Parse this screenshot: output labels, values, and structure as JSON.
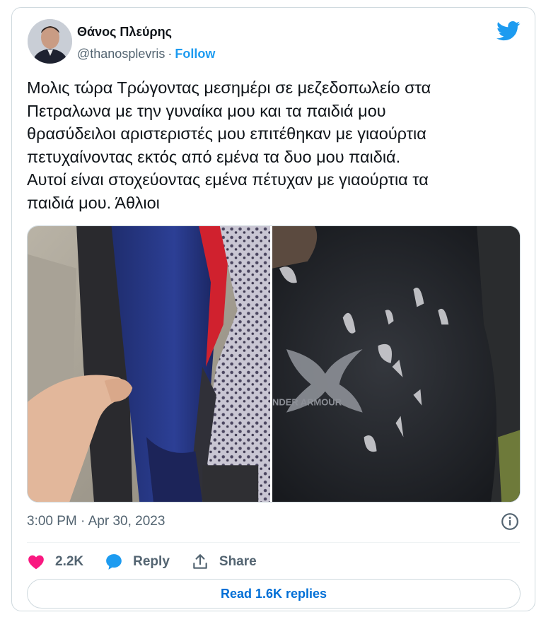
{
  "author": {
    "name": "Θάνος Πλεύρης",
    "handle": "@thanosplevris",
    "separator": "·",
    "follow_label": "Follow",
    "avatar_icon": "profile-photo",
    "brand_icon": "twitter-bird-icon",
    "brand_color": "#1d9bf0"
  },
  "tweet": {
    "text": "Μολις τώρα Τρώγοντας μεσημέρι σε μεζεδοπωλείο στα\nΠετραλωνα με την γυναίκα μου και τα παιδιά μου\nθρασύδειλοι αριστεριστές μου επιτέθηκαν με γιαούρτια\nπετυχαίνοντας εκτός από εμένα τα δυο μου παιδιά.\nΑυτοί είναι στοχεύοντας εμένα πέτυχαν με γιαούρτια τα\nπαιδιά μου. Άθλιοι",
    "timestamp": "3:00 PM · Apr 30, 2023",
    "info_icon": "info-icon"
  },
  "media": {
    "photos": [
      {
        "name": "jacket-photo",
        "shirt_text": ""
      },
      {
        "name": "sweatshirt-photo",
        "shirt_text": "NDER ARMOUR"
      }
    ]
  },
  "actions": {
    "like_count": "2.2K",
    "reply_label": "Reply",
    "share_label": "Share",
    "like_color": "#f91880",
    "reply_color": "#1d9bf0"
  },
  "footer": {
    "read_replies_label": "Read 1.6K replies"
  }
}
